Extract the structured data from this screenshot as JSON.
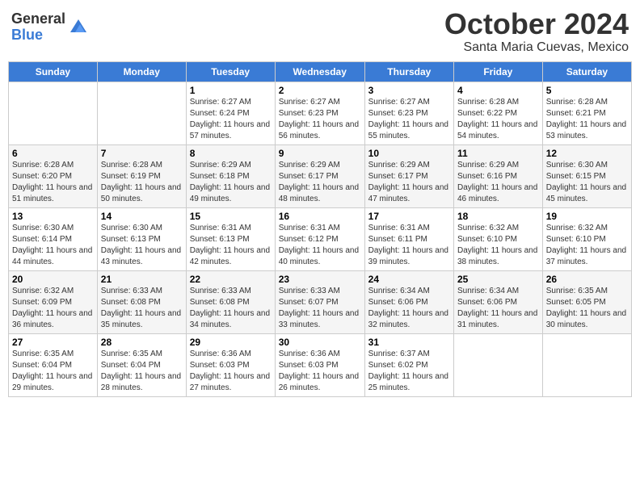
{
  "header": {
    "logo_general": "General",
    "logo_blue": "Blue",
    "month_title": "October 2024",
    "location": "Santa Maria Cuevas, Mexico"
  },
  "days_of_week": [
    "Sunday",
    "Monday",
    "Tuesday",
    "Wednesday",
    "Thursday",
    "Friday",
    "Saturday"
  ],
  "weeks": [
    [
      {
        "day": "",
        "sunrise": "",
        "sunset": "",
        "daylight": ""
      },
      {
        "day": "",
        "sunrise": "",
        "sunset": "",
        "daylight": ""
      },
      {
        "day": "1",
        "sunrise": "Sunrise: 6:27 AM",
        "sunset": "Sunset: 6:24 PM",
        "daylight": "Daylight: 11 hours and 57 minutes."
      },
      {
        "day": "2",
        "sunrise": "Sunrise: 6:27 AM",
        "sunset": "Sunset: 6:23 PM",
        "daylight": "Daylight: 11 hours and 56 minutes."
      },
      {
        "day": "3",
        "sunrise": "Sunrise: 6:27 AM",
        "sunset": "Sunset: 6:23 PM",
        "daylight": "Daylight: 11 hours and 55 minutes."
      },
      {
        "day": "4",
        "sunrise": "Sunrise: 6:28 AM",
        "sunset": "Sunset: 6:22 PM",
        "daylight": "Daylight: 11 hours and 54 minutes."
      },
      {
        "day": "5",
        "sunrise": "Sunrise: 6:28 AM",
        "sunset": "Sunset: 6:21 PM",
        "daylight": "Daylight: 11 hours and 53 minutes."
      }
    ],
    [
      {
        "day": "6",
        "sunrise": "Sunrise: 6:28 AM",
        "sunset": "Sunset: 6:20 PM",
        "daylight": "Daylight: 11 hours and 51 minutes."
      },
      {
        "day": "7",
        "sunrise": "Sunrise: 6:28 AM",
        "sunset": "Sunset: 6:19 PM",
        "daylight": "Daylight: 11 hours and 50 minutes."
      },
      {
        "day": "8",
        "sunrise": "Sunrise: 6:29 AM",
        "sunset": "Sunset: 6:18 PM",
        "daylight": "Daylight: 11 hours and 49 minutes."
      },
      {
        "day": "9",
        "sunrise": "Sunrise: 6:29 AM",
        "sunset": "Sunset: 6:17 PM",
        "daylight": "Daylight: 11 hours and 48 minutes."
      },
      {
        "day": "10",
        "sunrise": "Sunrise: 6:29 AM",
        "sunset": "Sunset: 6:17 PM",
        "daylight": "Daylight: 11 hours and 47 minutes."
      },
      {
        "day": "11",
        "sunrise": "Sunrise: 6:29 AM",
        "sunset": "Sunset: 6:16 PM",
        "daylight": "Daylight: 11 hours and 46 minutes."
      },
      {
        "day": "12",
        "sunrise": "Sunrise: 6:30 AM",
        "sunset": "Sunset: 6:15 PM",
        "daylight": "Daylight: 11 hours and 45 minutes."
      }
    ],
    [
      {
        "day": "13",
        "sunrise": "Sunrise: 6:30 AM",
        "sunset": "Sunset: 6:14 PM",
        "daylight": "Daylight: 11 hours and 44 minutes."
      },
      {
        "day": "14",
        "sunrise": "Sunrise: 6:30 AM",
        "sunset": "Sunset: 6:13 PM",
        "daylight": "Daylight: 11 hours and 43 minutes."
      },
      {
        "day": "15",
        "sunrise": "Sunrise: 6:31 AM",
        "sunset": "Sunset: 6:13 PM",
        "daylight": "Daylight: 11 hours and 42 minutes."
      },
      {
        "day": "16",
        "sunrise": "Sunrise: 6:31 AM",
        "sunset": "Sunset: 6:12 PM",
        "daylight": "Daylight: 11 hours and 40 minutes."
      },
      {
        "day": "17",
        "sunrise": "Sunrise: 6:31 AM",
        "sunset": "Sunset: 6:11 PM",
        "daylight": "Daylight: 11 hours and 39 minutes."
      },
      {
        "day": "18",
        "sunrise": "Sunrise: 6:32 AM",
        "sunset": "Sunset: 6:10 PM",
        "daylight": "Daylight: 11 hours and 38 minutes."
      },
      {
        "day": "19",
        "sunrise": "Sunrise: 6:32 AM",
        "sunset": "Sunset: 6:10 PM",
        "daylight": "Daylight: 11 hours and 37 minutes."
      }
    ],
    [
      {
        "day": "20",
        "sunrise": "Sunrise: 6:32 AM",
        "sunset": "Sunset: 6:09 PM",
        "daylight": "Daylight: 11 hours and 36 minutes."
      },
      {
        "day": "21",
        "sunrise": "Sunrise: 6:33 AM",
        "sunset": "Sunset: 6:08 PM",
        "daylight": "Daylight: 11 hours and 35 minutes."
      },
      {
        "day": "22",
        "sunrise": "Sunrise: 6:33 AM",
        "sunset": "Sunset: 6:08 PM",
        "daylight": "Daylight: 11 hours and 34 minutes."
      },
      {
        "day": "23",
        "sunrise": "Sunrise: 6:33 AM",
        "sunset": "Sunset: 6:07 PM",
        "daylight": "Daylight: 11 hours and 33 minutes."
      },
      {
        "day": "24",
        "sunrise": "Sunrise: 6:34 AM",
        "sunset": "Sunset: 6:06 PM",
        "daylight": "Daylight: 11 hours and 32 minutes."
      },
      {
        "day": "25",
        "sunrise": "Sunrise: 6:34 AM",
        "sunset": "Sunset: 6:06 PM",
        "daylight": "Daylight: 11 hours and 31 minutes."
      },
      {
        "day": "26",
        "sunrise": "Sunrise: 6:35 AM",
        "sunset": "Sunset: 6:05 PM",
        "daylight": "Daylight: 11 hours and 30 minutes."
      }
    ],
    [
      {
        "day": "27",
        "sunrise": "Sunrise: 6:35 AM",
        "sunset": "Sunset: 6:04 PM",
        "daylight": "Daylight: 11 hours and 29 minutes."
      },
      {
        "day": "28",
        "sunrise": "Sunrise: 6:35 AM",
        "sunset": "Sunset: 6:04 PM",
        "daylight": "Daylight: 11 hours and 28 minutes."
      },
      {
        "day": "29",
        "sunrise": "Sunrise: 6:36 AM",
        "sunset": "Sunset: 6:03 PM",
        "daylight": "Daylight: 11 hours and 27 minutes."
      },
      {
        "day": "30",
        "sunrise": "Sunrise: 6:36 AM",
        "sunset": "Sunset: 6:03 PM",
        "daylight": "Daylight: 11 hours and 26 minutes."
      },
      {
        "day": "31",
        "sunrise": "Sunrise: 6:37 AM",
        "sunset": "Sunset: 6:02 PM",
        "daylight": "Daylight: 11 hours and 25 minutes."
      },
      {
        "day": "",
        "sunrise": "",
        "sunset": "",
        "daylight": ""
      },
      {
        "day": "",
        "sunrise": "",
        "sunset": "",
        "daylight": ""
      }
    ]
  ]
}
